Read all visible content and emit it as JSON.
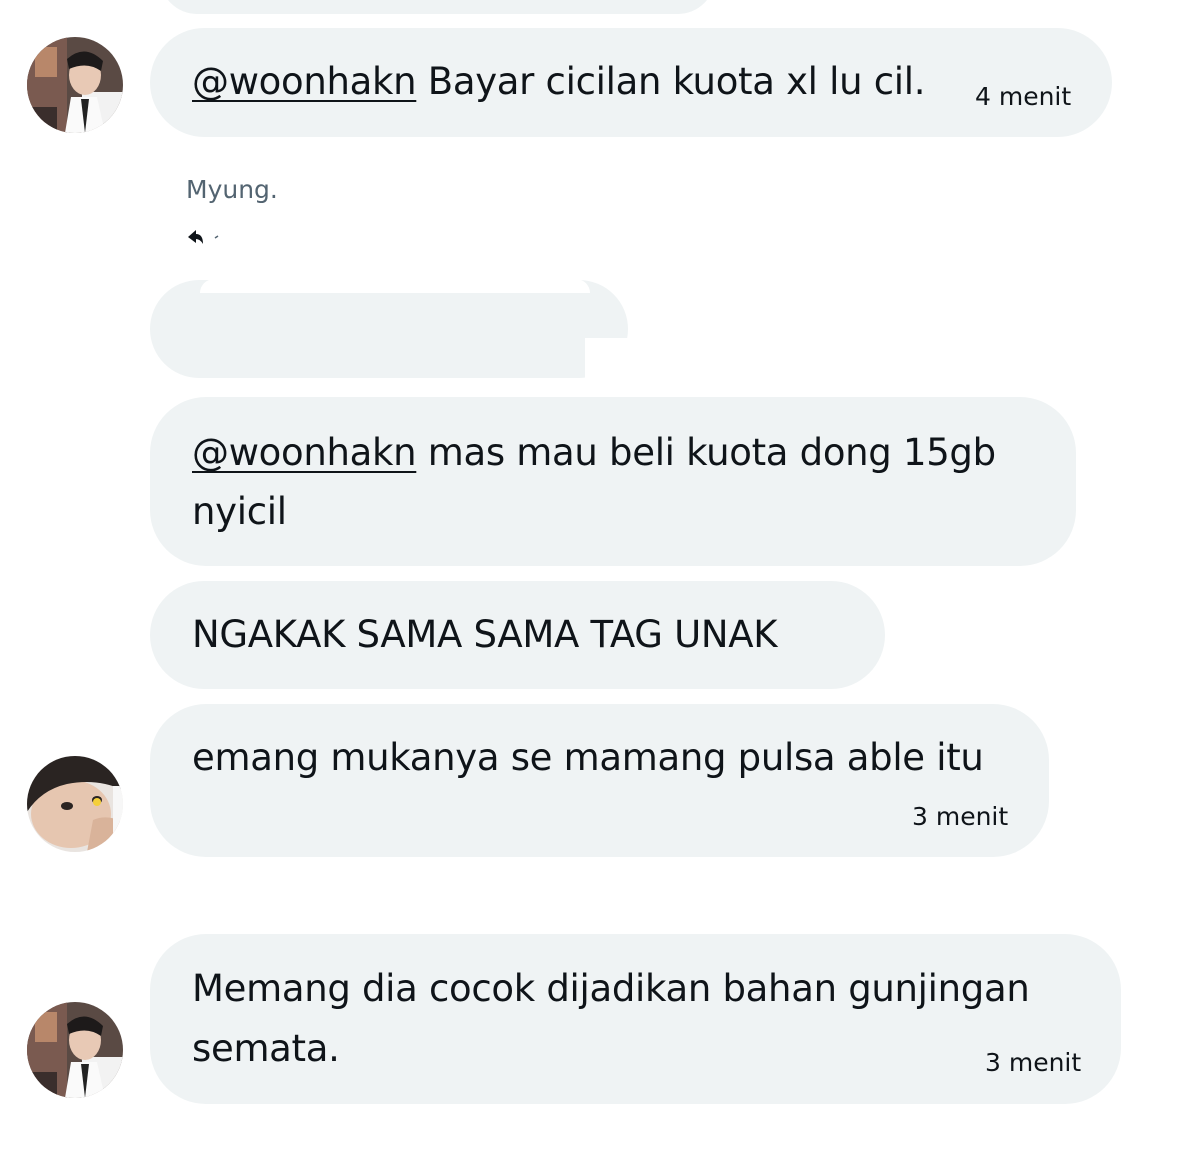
{
  "messages": [
    {
      "mention": "@woonhakn",
      "text": " Bayar cicilan kuota xl lu cil.",
      "time": "4 menit"
    },
    {
      "sender": "Myung."
    },
    {
      "mention": "@woonhakn",
      "line1": " mas mau beli kuota dong 15gb",
      "line2": "nyicil"
    },
    {
      "text": "NGAKAK SAMA SAMA TAG UNAK"
    },
    {
      "text": "emang mukanya se mamang pulsa able itu",
      "time": "3 menit"
    },
    {
      "line1": "Memang dia cocok dijadikan bahan gunjingan",
      "line2": "semata.",
      "time": "3 menit"
    }
  ],
  "icons": {
    "reply": "reply-arrow-icon",
    "avatar_a": "avatar",
    "avatar_b": "avatar"
  },
  "colors": {
    "bubble": "#eff3f4",
    "text": "#0f1419",
    "muted": "#536471"
  }
}
